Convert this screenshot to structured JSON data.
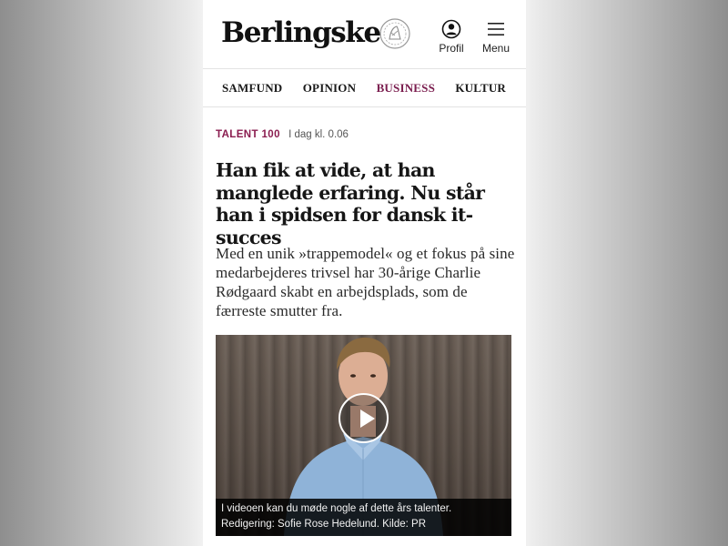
{
  "header": {
    "logo_text": "Berlingske",
    "profile_label": "Profil",
    "menu_label": "Menu"
  },
  "nav": {
    "items": [
      {
        "label": "SAMFUND",
        "active": false
      },
      {
        "label": "OPINION",
        "active": false
      },
      {
        "label": "BUSINESS",
        "active": true
      },
      {
        "label": "KULTUR",
        "active": false
      }
    ]
  },
  "article": {
    "kicker": "TALENT 100",
    "timestamp": "I dag kl. 0.06",
    "headline": "Han fik at vide, at han manglede erfaring. Nu står han i spidsen for dansk it-succes",
    "lead": "Med en unik »trappemodel« og et fokus på sine medarbejderes trivsel har 30-årige Charlie Rødgaard skabt en arbejdsplads, som de færreste smutter fra.",
    "video_caption": "I videoen kan du møde nogle af dette års talenter. Redigering: Sofie Rose Hedelund. Kilde: PR"
  },
  "colors": {
    "accent": "#7a1d4e",
    "kicker": "#8a1c4f",
    "text": "#161616"
  },
  "icons": {
    "profile": "user-circle-icon",
    "menu": "hamburger-menu-icon",
    "play": "play-icon",
    "crest": "crest-logo-icon"
  }
}
